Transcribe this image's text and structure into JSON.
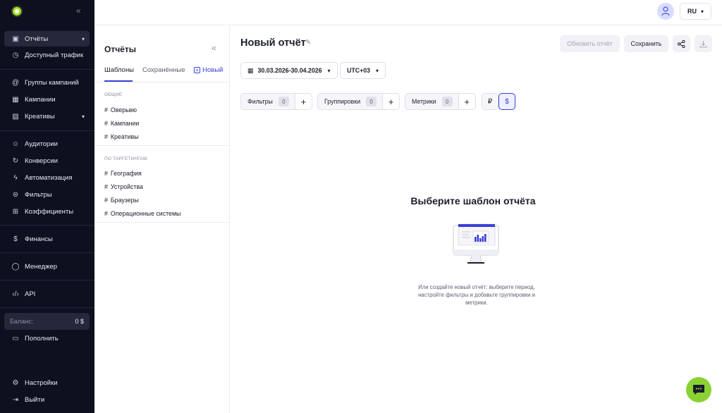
{
  "sidebar": {
    "items": [
      {
        "icon": "chart-icon",
        "label": "Отчёты"
      },
      {
        "icon": "clock-icon",
        "label": "Доступный трафик"
      },
      {
        "icon": "at-icon",
        "label": "Группы кампаний"
      },
      {
        "icon": "grid-icon",
        "label": "Кампании"
      },
      {
        "icon": "image-icon",
        "label": "Креативы"
      },
      {
        "icon": "users-icon",
        "label": "Аудитории"
      },
      {
        "icon": "refresh-icon",
        "label": "Конверсии"
      },
      {
        "icon": "bolt-icon",
        "label": "Автоматизация"
      },
      {
        "icon": "filter-icon",
        "label": "Фильтры"
      },
      {
        "icon": "table-icon",
        "label": "Коэффициенты"
      },
      {
        "icon": "dollar-icon",
        "label": "Финансы"
      },
      {
        "icon": "chat-icon",
        "label": "Менеджер"
      },
      {
        "icon": "code-icon",
        "label": "API"
      },
      {
        "icon": "wallet-icon",
        "label": "Пополнить"
      },
      {
        "icon": "gear-icon",
        "label": "Настройки"
      },
      {
        "icon": "logout-icon",
        "label": "Выйти"
      }
    ],
    "balance_label": "Баланс:",
    "balance_value": "0 $"
  },
  "reports_panel": {
    "title": "Отчёты",
    "tabs": [
      "Шаблоны",
      "Сохранённые"
    ],
    "new_label": "Новый",
    "sections": [
      {
        "title": "ОБЩИЕ",
        "items": [
          "Оверьвю",
          "Кампании",
          "Креативы"
        ]
      },
      {
        "title": "ПО ТАРГЕТИНГАМ",
        "items": [
          "География",
          "Устройства",
          "Браузеры",
          "Операционные системы"
        ]
      }
    ]
  },
  "topbar": {
    "language": "RU"
  },
  "main": {
    "title": "Новый отчёт",
    "refresh_label": "Обновить отчёт",
    "save_label": "Сохранить",
    "date_range": "30.03.2026-30.04.2026",
    "timezone": "UTC+03",
    "chips": [
      {
        "label": "Фильтры",
        "count": "0"
      },
      {
        "label": "Группировки",
        "count": "0"
      },
      {
        "label": "Метрики",
        "count": "0"
      }
    ],
    "currencies": [
      "₽",
      "$"
    ],
    "empty_title": "Выберите шаблон отчёта",
    "empty_text": "Или создайте новый отчёт: выберите период, настройте фильтры и добавьте группировки и метрики."
  },
  "colors": {
    "sidebar_bg": "#0e0f1f",
    "accent": "#3b3fd8",
    "brand_green": "#8ad234"
  }
}
